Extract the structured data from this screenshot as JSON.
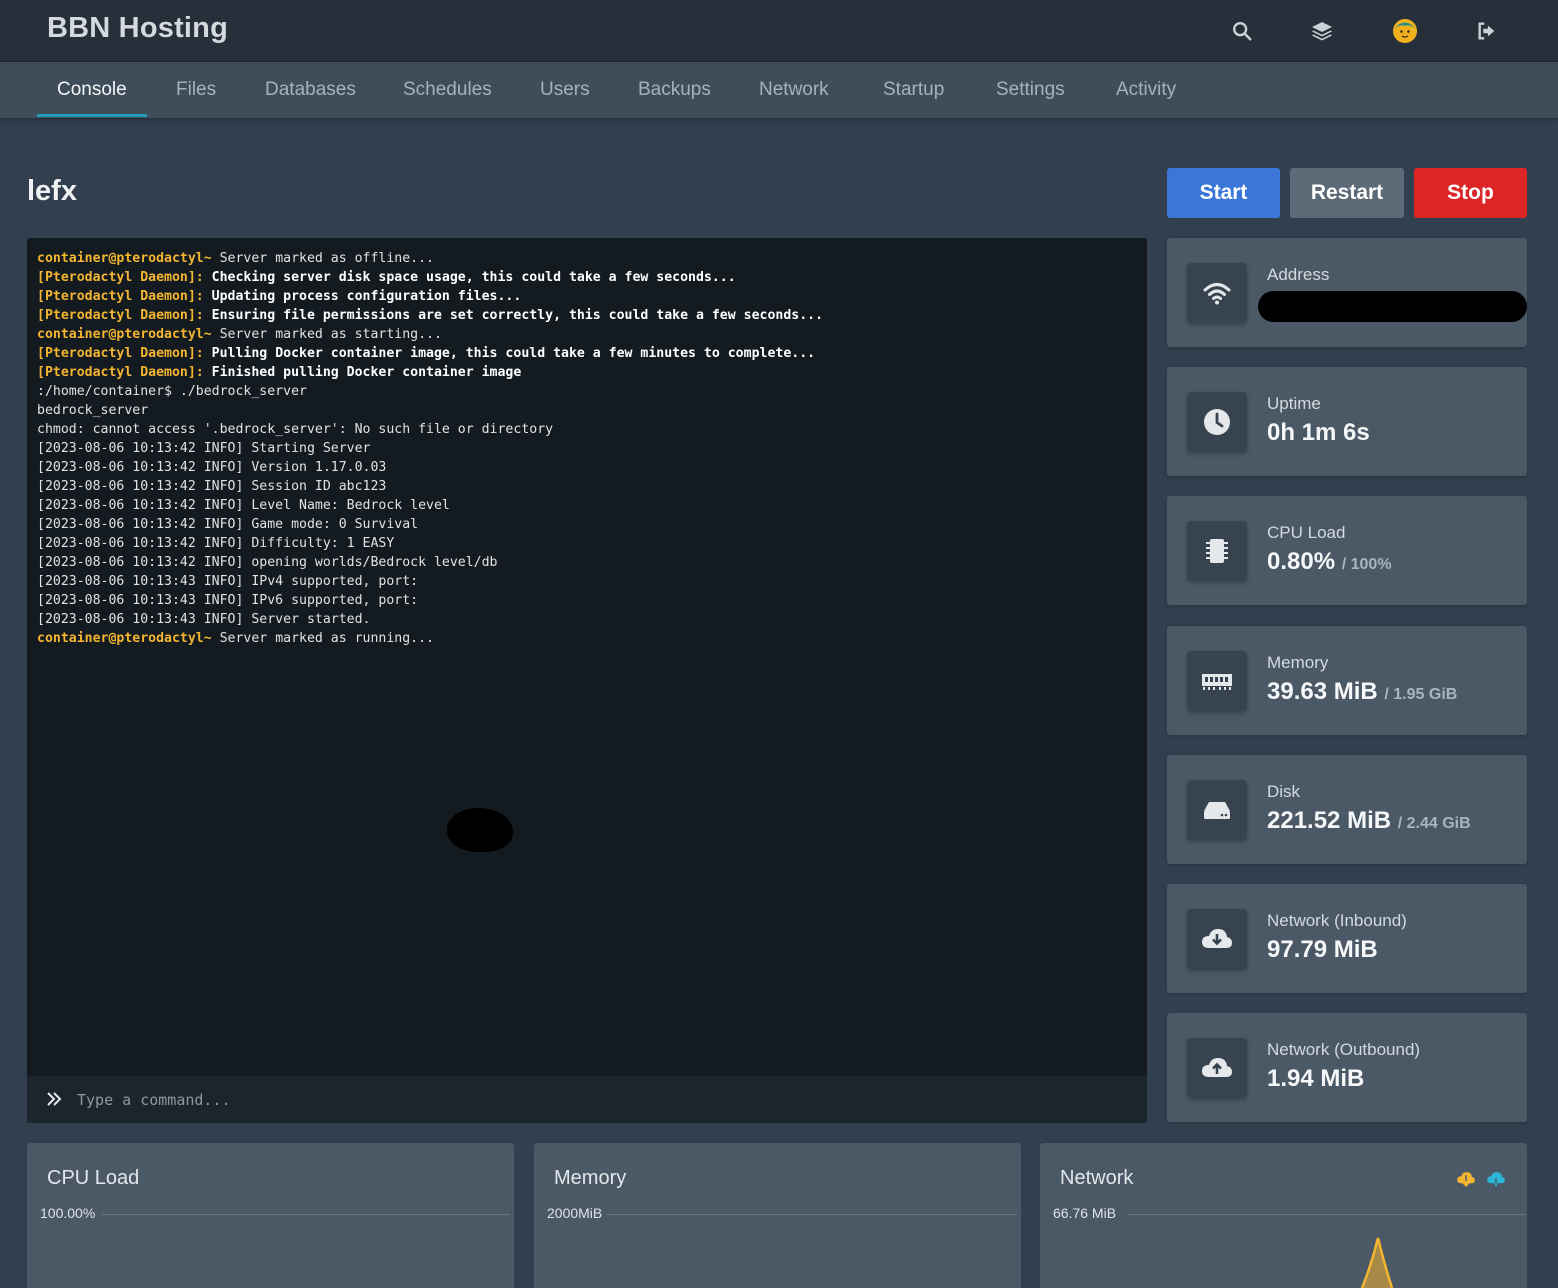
{
  "app": {
    "brand": "BBN Hosting"
  },
  "topbar_icons": [
    "search-icon",
    "layers-icon",
    "avatar",
    "logout-icon"
  ],
  "nav": {
    "tabs": [
      "Console",
      "Files",
      "Databases",
      "Schedules",
      "Users",
      "Backups",
      "Network",
      "Startup",
      "Settings",
      "Activity"
    ],
    "active": "Console"
  },
  "server": {
    "name": "lefx"
  },
  "power": {
    "start": "Start",
    "restart": "Restart",
    "stop": "Stop"
  },
  "colors": {
    "start": "#3a77d8",
    "restart": "#5d6a77",
    "stop": "#dc2626",
    "prompt": "#f4b530",
    "tab_underline": "#1f9ab8"
  },
  "console": {
    "input_placeholder": "Type a command...",
    "lines": [
      {
        "type": "prompt",
        "prefix": "container@pterodactyl~",
        "text": " Server marked as offline..."
      },
      {
        "type": "daemon",
        "prefix": "[Pterodactyl Daemon]:",
        "text": " Checking server disk space usage, this could take a few seconds..."
      },
      {
        "type": "daemon",
        "prefix": "[Pterodactyl Daemon]:",
        "text": " Updating process configuration files..."
      },
      {
        "type": "daemon",
        "prefix": "[Pterodactyl Daemon]:",
        "text": " Ensuring file permissions are set correctly, this could take a few seconds..."
      },
      {
        "type": "prompt",
        "prefix": "container@pterodactyl~",
        "text": " Server marked as starting..."
      },
      {
        "type": "daemon",
        "prefix": "[Pterodactyl Daemon]:",
        "text": " Pulling Docker container image, this could take a few minutes to complete..."
      },
      {
        "type": "daemon",
        "prefix": "[Pterodactyl Daemon]:",
        "text": " Finished pulling Docker container image"
      },
      {
        "type": "plain",
        "prefix": "",
        "text": ":/home/container$ ./bedrock_server"
      },
      {
        "type": "plain",
        "prefix": "",
        "text": "bedrock_server"
      },
      {
        "type": "plain",
        "prefix": "",
        "text": "chmod: cannot access '.bedrock_server': No such file or directory"
      },
      {
        "type": "plain",
        "prefix": "",
        "text": "[2023-08-06 10:13:42 INFO] Starting Server"
      },
      {
        "type": "plain",
        "prefix": "",
        "text": "[2023-08-06 10:13:42 INFO] Version 1.17.0.03"
      },
      {
        "type": "plain",
        "prefix": "",
        "text": "[2023-08-06 10:13:42 INFO] Session ID abc123"
      },
      {
        "type": "plain",
        "prefix": "",
        "text": "[2023-08-06 10:13:42 INFO] Level Name: Bedrock level"
      },
      {
        "type": "plain",
        "prefix": "",
        "text": "[2023-08-06 10:13:42 INFO] Game mode: 0 Survival"
      },
      {
        "type": "plain",
        "prefix": "",
        "text": "[2023-08-06 10:13:42 INFO] Difficulty: 1 EASY"
      },
      {
        "type": "plain",
        "prefix": "",
        "text": "[2023-08-06 10:13:42 INFO] opening worlds/Bedrock level/db"
      },
      {
        "type": "plain",
        "prefix": "",
        "text": "[2023-08-06 10:13:43 INFO] IPv4 supported, port:"
      },
      {
        "type": "plain",
        "prefix": "",
        "text": "[2023-08-06 10:13:43 INFO] IPv6 supported, port:"
      },
      {
        "type": "plain",
        "prefix": "",
        "text": "[2023-08-06 10:13:43 INFO] Server started."
      },
      {
        "type": "prompt",
        "prefix": "container@pterodactyl~",
        "text": " Server marked as running..."
      }
    ]
  },
  "stats": {
    "address": {
      "label": "Address",
      "icon": "wifi-icon"
    },
    "uptime": {
      "label": "Uptime",
      "value": "0h 1m 6s",
      "icon": "clock-icon"
    },
    "cpu": {
      "label": "CPU Load",
      "value": "0.80%",
      "limit": "/ 100%",
      "icon": "cpu-icon"
    },
    "memory": {
      "label": "Memory",
      "value": "39.63 MiB",
      "limit": "/ 1.95 GiB",
      "icon": "memory-icon"
    },
    "disk": {
      "label": "Disk",
      "value": "221.52 MiB",
      "limit": "/ 2.44 GiB",
      "icon": "hdd-icon"
    },
    "net_in": {
      "label": "Network (Inbound)",
      "value": "97.79 MiB",
      "icon": "cloud-download-icon"
    },
    "net_out": {
      "label": "Network (Outbound)",
      "value": "1.94 MiB",
      "icon": "cloud-upload-icon"
    }
  },
  "graphs": {
    "cpu": {
      "title": "CPU Load",
      "ymax_label": "100.00%"
    },
    "memory": {
      "title": "Memory",
      "ymax_label": "2000MiB"
    },
    "network": {
      "title": "Network",
      "ymax_label": "66.76 MiB",
      "legend_icons": [
        "cloud-download-icon",
        "cloud-upload-icon"
      ],
      "legend_colors": [
        "#f4b530",
        "#2bb6d9"
      ]
    }
  }
}
